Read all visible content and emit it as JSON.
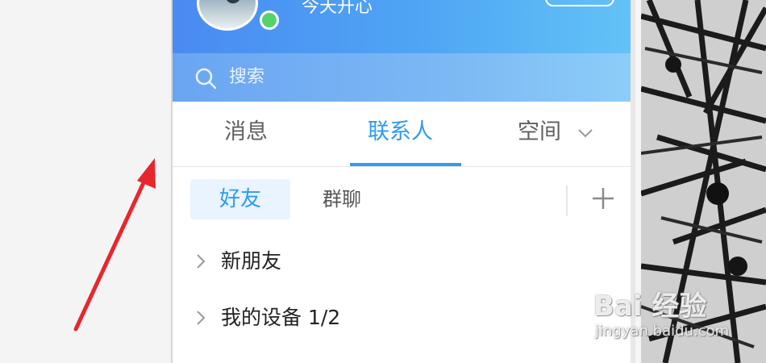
{
  "header": {
    "status_text": "今天开心"
  },
  "search": {
    "placeholder": "搜索"
  },
  "tabs": [
    {
      "label": "消息",
      "active": false
    },
    {
      "label": "联系人",
      "active": true
    },
    {
      "label": "空间",
      "active": false
    }
  ],
  "subtabs": {
    "friends": "好友",
    "groups": "群聊"
  },
  "contact_groups": [
    {
      "label": "新朋友"
    },
    {
      "label": "我的设备 1/2"
    }
  ],
  "watermark": {
    "brand": "Bai 经验",
    "domain": "jingyan.baidu.com"
  },
  "colors": {
    "accent": "#2d9bf0",
    "header_start": "#4a8af2",
    "header_end": "#63c2f6",
    "online": "#56d26b",
    "annotation_arrow": "#e8262d"
  }
}
